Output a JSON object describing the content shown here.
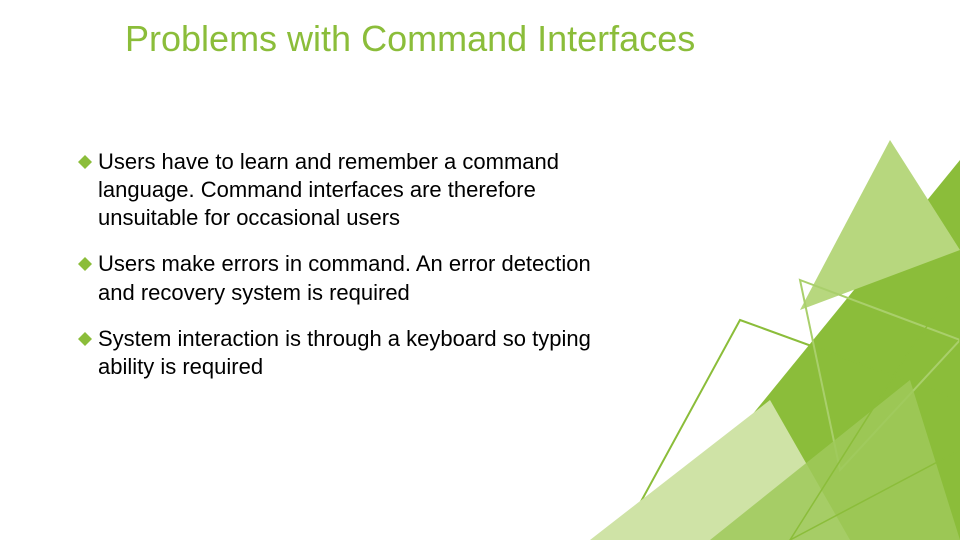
{
  "title": "Problems with Command Interfaces",
  "bullets": [
    "Users have to learn and remember a command language. Command interfaces are therefore unsuitable for occasional users",
    "Users make errors in command. An error detection and recovery system is required",
    "System interaction is through a keyboard so typing ability is required"
  ],
  "accent": "#8bbd3a"
}
